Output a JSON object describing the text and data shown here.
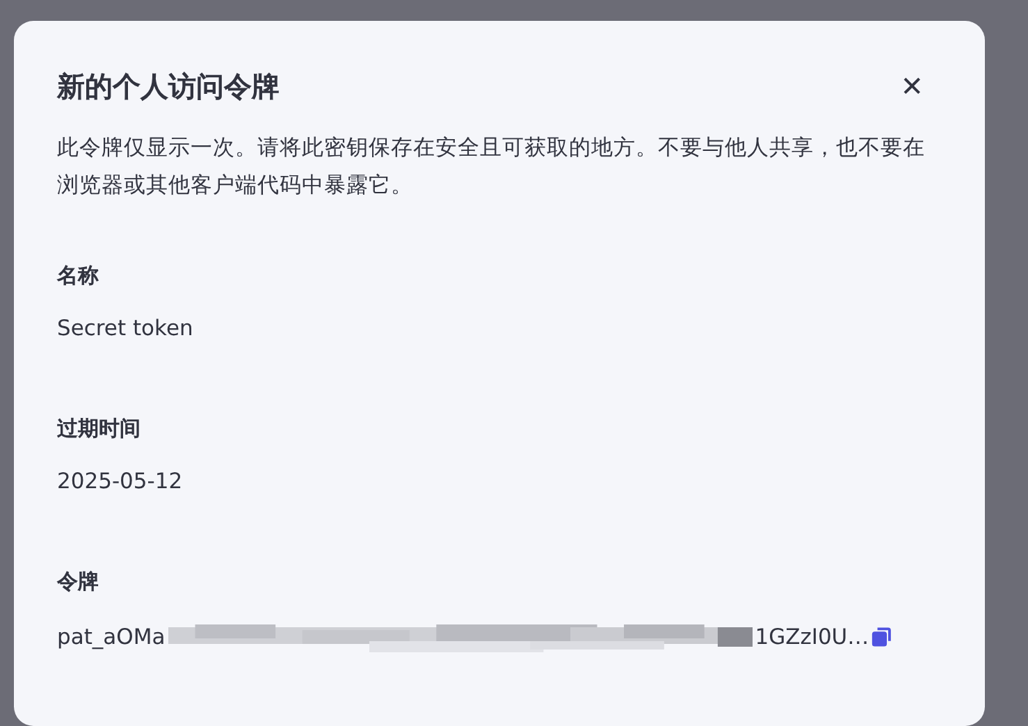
{
  "dialog": {
    "title": "新的个人访问令牌",
    "close_icon": "✕",
    "description": "此令牌仅显示一次。请将此密钥保存在安全且可获取的地方。不要与他人共享，也不要在浏览器或其他客户端代码中暴露它。",
    "fields": [
      {
        "label": "名称",
        "value": "Secret token"
      },
      {
        "label": "过期时间",
        "value": "2025-05-12"
      }
    ],
    "token": {
      "label": "令牌",
      "prefix": "pat_aOMa",
      "suffix": "1GZzI0U…"
    }
  }
}
